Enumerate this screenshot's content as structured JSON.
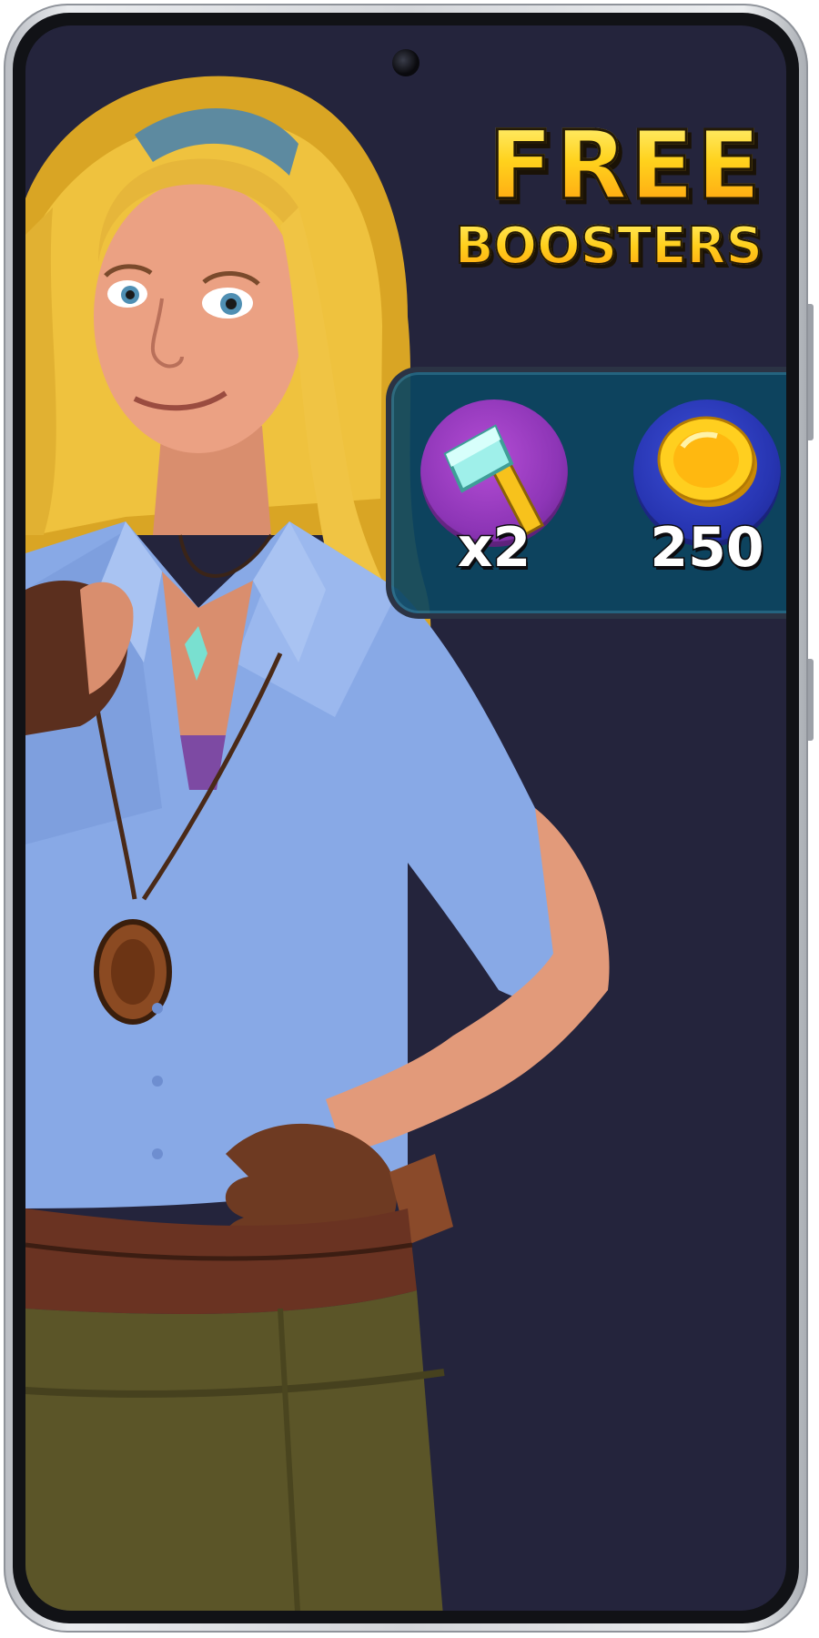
{
  "promo": {
    "title_line1": "FREE",
    "title_line2": "BOOSTERS"
  },
  "rewards": [
    {
      "icon": "hammer-icon",
      "count": "x2"
    },
    {
      "icon": "coin-icon",
      "count": "250"
    }
  ],
  "colors": {
    "background": "#24243c",
    "title_gold": "#ffc21a",
    "panel": "#0c4662",
    "hammer_badge": "#8d35b6",
    "coin_badge": "#2735b2"
  }
}
